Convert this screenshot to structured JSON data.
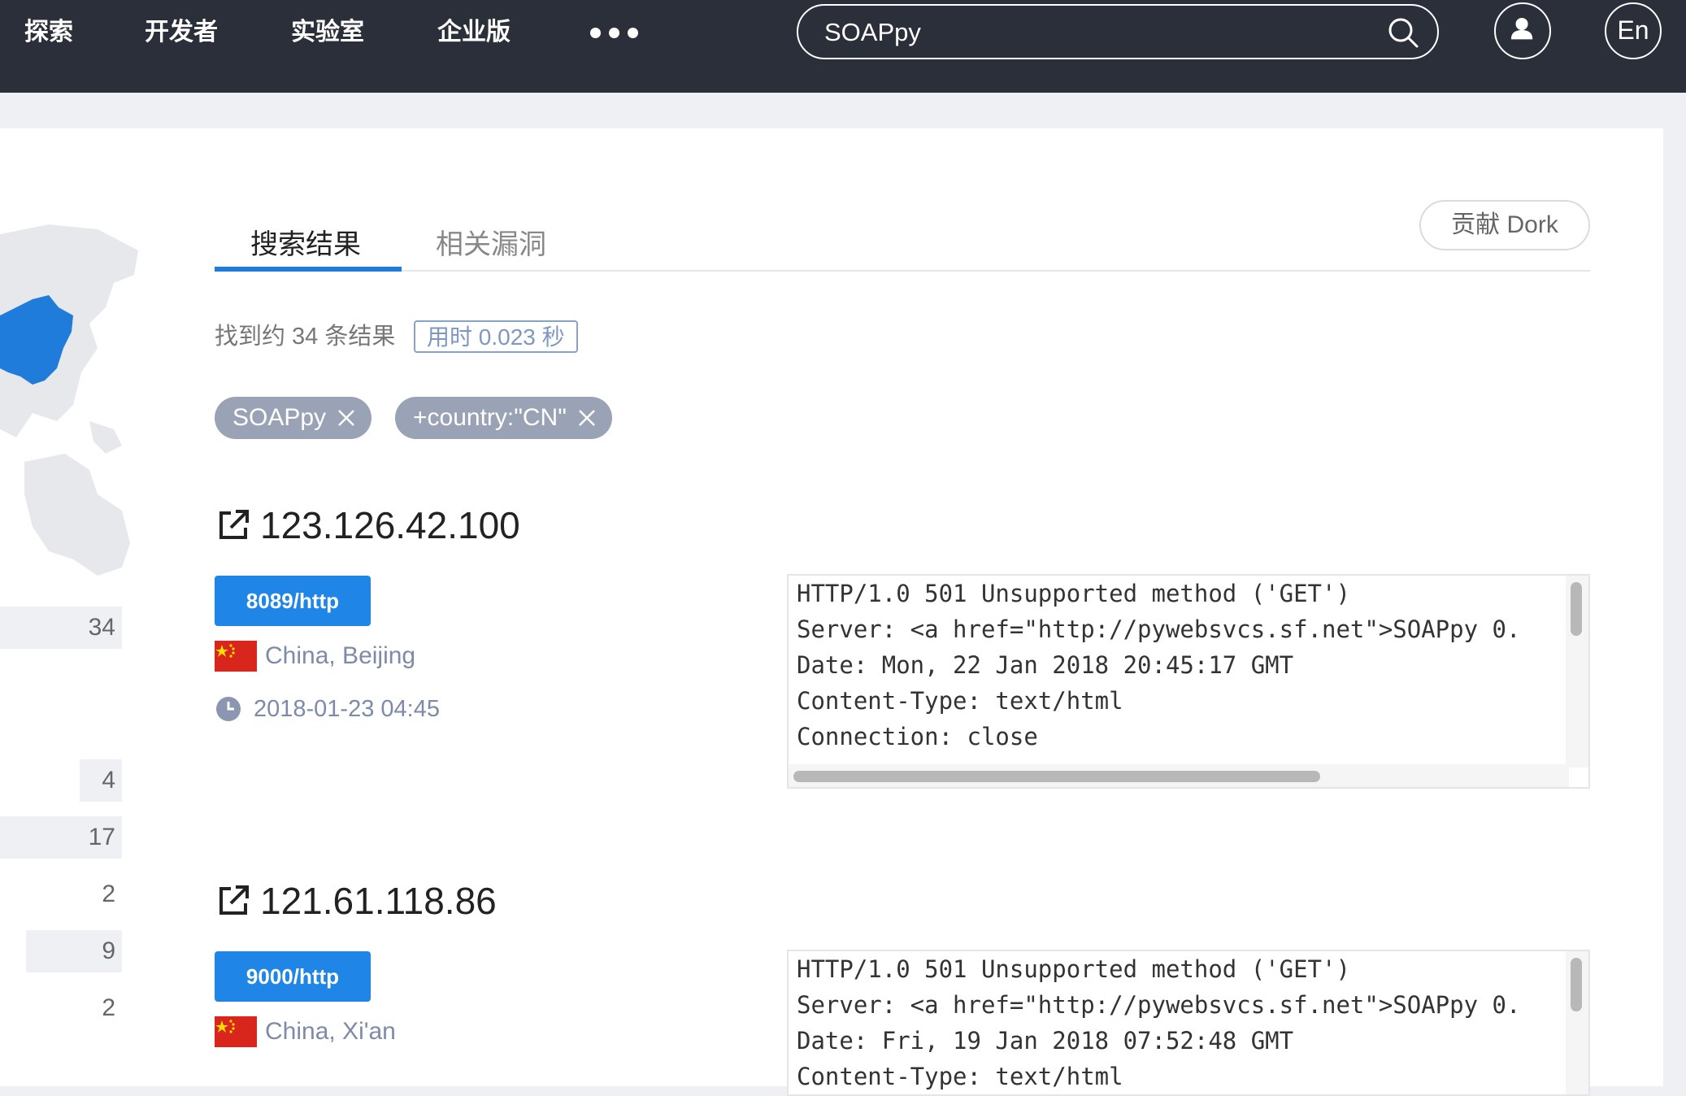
{
  "nav": {
    "items": [
      "探索",
      "开发者",
      "实验室",
      "企业版"
    ],
    "more_icon": "more-dots-icon",
    "search_value": "SOAPpy",
    "search_icon": "search-icon",
    "user_icon": "user-icon",
    "lang_label": "En"
  },
  "sidebar": {
    "stats": [
      "34",
      "4",
      "17",
      "2",
      "9",
      "2"
    ],
    "map_highlight_color": "#1f7cdb"
  },
  "tabs": {
    "active": "搜索结果",
    "inactive": "相关漏洞",
    "dork_button": "贡献 Dork"
  },
  "summary": {
    "count_text": "找到约 34 条结果",
    "time_text": "用时 0.023 秒"
  },
  "filters": [
    {
      "label": "SOAPpy"
    },
    {
      "label": "+country:\"CN\""
    }
  ],
  "results": [
    {
      "ip": "121.61.118.86",
      "port": "9000/http",
      "location": "China, Xi'an",
      "banner": [
        "HTTP/1.0 501 Unsupported method ('GET')",
        "Server: <a href=\"http://pywebsvcs.sf.net\">SOAPpy 0.",
        "Date: Fri, 19 Jan 2018 07:52:48 GMT",
        "Content-Type: text/html"
      ]
    }
  ],
  "first_result": {
    "ip": "123.126.42.100",
    "port": "8089/http",
    "location": "China, Beijing",
    "time": "2018-01-23 04:45",
    "banner": [
      "HTTP/1.0 501 Unsupported method ('GET')",
      "Server: <a href=\"http://pywebsvcs.sf.net\">SOAPpy 0.",
      "Date: Mon, 22 Jan 2018 20:45:17 GMT",
      "Content-Type: text/html",
      "Connection: close"
    ]
  },
  "colors": {
    "topbar": "#2b2f3a",
    "accent": "#1f86e8",
    "chip": "#9aa3b6",
    "flag_red": "#d9261c",
    "flag_star": "#ffde00"
  }
}
